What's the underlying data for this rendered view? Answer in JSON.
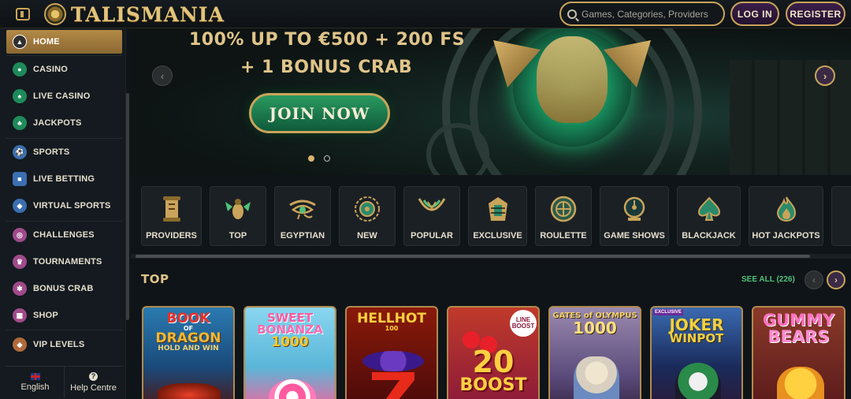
{
  "header": {
    "brand": "TALISMANIA",
    "search_placeholder": "Games, Categories, Providers",
    "login_label": "LOG IN",
    "register_label": "REGISTER"
  },
  "sidebar": {
    "items": [
      {
        "label": "HOME",
        "icon": "pyramid-icon",
        "color": "#2f2f2f"
      },
      {
        "label": "CASINO",
        "icon": "chip-icon",
        "color": "#1e8a5a"
      },
      {
        "label": "LIVE CASINO",
        "icon": "spade-icon",
        "color": "#1e8a5a"
      },
      {
        "label": "JACKPOTS",
        "icon": "clover-icon",
        "color": "#1e8a5a"
      },
      {
        "label": "SPORTS",
        "icon": "ball-icon",
        "color": "#3a6fb0"
      },
      {
        "label": "LIVE BETTING",
        "icon": "live-icon",
        "color": "#3a6fb0"
      },
      {
        "label": "VIRTUAL SPORTS",
        "icon": "gamepad-icon",
        "color": "#3a6fb0"
      },
      {
        "label": "CHALLENGES",
        "icon": "challenge-icon",
        "color": "#a04a8a"
      },
      {
        "label": "TOURNAMENTS",
        "icon": "trophy-icon",
        "color": "#a04a8a"
      },
      {
        "label": "BONUS CRAB",
        "icon": "crab-icon",
        "color": "#a04a8a"
      },
      {
        "label": "SHOP",
        "icon": "shop-icon",
        "color": "#a04a8a"
      },
      {
        "label": "VIP LEVELS",
        "icon": "diamond-icon",
        "color": "#b06a3a"
      }
    ],
    "language": "English",
    "help": "Help Centre"
  },
  "hero": {
    "line1": "100% UP TO €500 + 200 FS",
    "line2": "+ 1 BONUS CRAB",
    "cta": "JOIN NOW"
  },
  "categories": [
    {
      "label": "PROVIDERS",
      "icon": "scroll-icon"
    },
    {
      "label": "TOP",
      "icon": "scarab-icon"
    },
    {
      "label": "EGYPTIAN",
      "icon": "eye-of-horus-icon"
    },
    {
      "label": "NEW",
      "icon": "sun-icon"
    },
    {
      "label": "POPULAR",
      "icon": "collar-icon"
    },
    {
      "label": "EXCLUSIVE",
      "icon": "pharaoh-icon"
    },
    {
      "label": "ROULETTE",
      "icon": "roulette-icon"
    },
    {
      "label": "GAME SHOWS",
      "icon": "wheel-icon"
    },
    {
      "label": "BLACKJACK",
      "icon": "spade-icon"
    },
    {
      "label": "HOT JACKPOTS",
      "icon": "flame-icon"
    }
  ],
  "top_section": {
    "title": "TOP",
    "see_all": "SEE ALL (226)"
  },
  "games": [
    {
      "title": "BOOK OF DRAGON HOLD AND WIN",
      "line1": "BOOK",
      "line2": "DRAGON",
      "line3": "HOLD AND WIN",
      "bg": "#1a6a9a"
    },
    {
      "title": "SWEET BONANZA 1000",
      "line1": "SWEET",
      "line2": "BONANZA",
      "line3": "1000",
      "bg": "#5ab6d8"
    },
    {
      "title": "HELL HOT 100",
      "line1": "HELLHOT",
      "line2": "100",
      "line3": "",
      "bg": "#6a0a0a"
    },
    {
      "title": "LINE BOOST 20 BOOST",
      "line1": "LINE BOOST",
      "line2": "20",
      "line3": "BOOST",
      "bg": "#7a1a1a"
    },
    {
      "title": "GATES OF OLYMPUS 1000",
      "line1": "GATES of OLYMPUS",
      "line2": "1000",
      "line3": "",
      "bg": "#6a5a8a"
    },
    {
      "title": "JOKER WINPOT",
      "line1": "EXCLUSIVE",
      "line2": "JOKER",
      "line3": "WINPOT",
      "bg": "#1a3a6a"
    },
    {
      "title": "GUMMY BEARS",
      "line1": "GUMMY",
      "line2": "BEARS",
      "line3": "",
      "bg": "#6a2a1a"
    }
  ]
}
